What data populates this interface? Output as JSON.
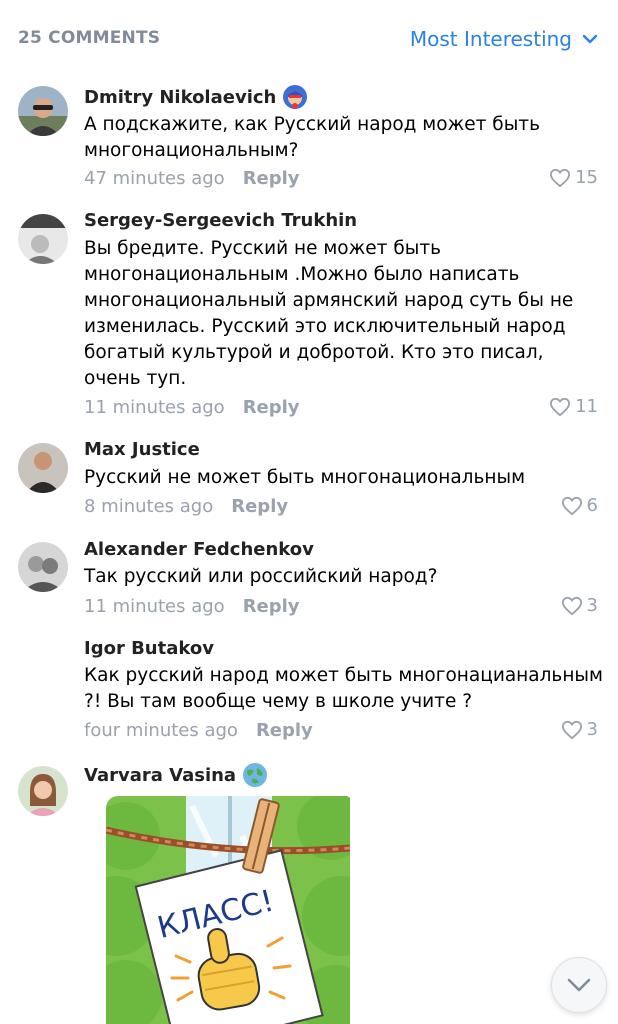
{
  "header": {
    "count_label": "25 COMMENTS",
    "sort_label": "Most Interesting"
  },
  "colors": {
    "accent": "#2a82e4",
    "secondary_text": "#99a2ad"
  },
  "comments": [
    {
      "author": "Dmitry Nikolaevich",
      "badge": "superhero-badge-icon",
      "text": "А подскажите, как Русский народ может быть многонациональным?",
      "time": "47 minutes ago",
      "reply": "Reply",
      "likes": "15"
    },
    {
      "author": "Sergey-Sergeevich Trukhin",
      "text": "Вы бредите. Русский не может  быть многонациональным .Можно было написать многонациональный армянский народ суть бы не изменилась. Русский это исключительный народ богатый культурой и добротой. Кто это писал, очень туп.",
      "time": "11 minutes ago",
      "reply": "Reply",
      "likes": "11"
    },
    {
      "author": "Max Justice",
      "text": "Русский не может быть многонациональным",
      "time": "8 minutes ago",
      "reply": "Reply",
      "likes": "6"
    },
    {
      "author": "Alexander Fedchenkov",
      "text": "Так русский или российский народ?",
      "time": "11 minutes ago",
      "reply": "Reply",
      "likes": "3"
    },
    {
      "author": "Igor Butakov",
      "text": "Как русский народ может быть многонацианальным ?! Вы там вообще чему в школе учите ?",
      "time": "four minutes ago",
      "reply": "Reply",
      "likes": "3"
    },
    {
      "author": "Varvara Vasina",
      "badge": "globe-badge-icon",
      "sticker_text": "КЛАСС!"
    }
  ]
}
